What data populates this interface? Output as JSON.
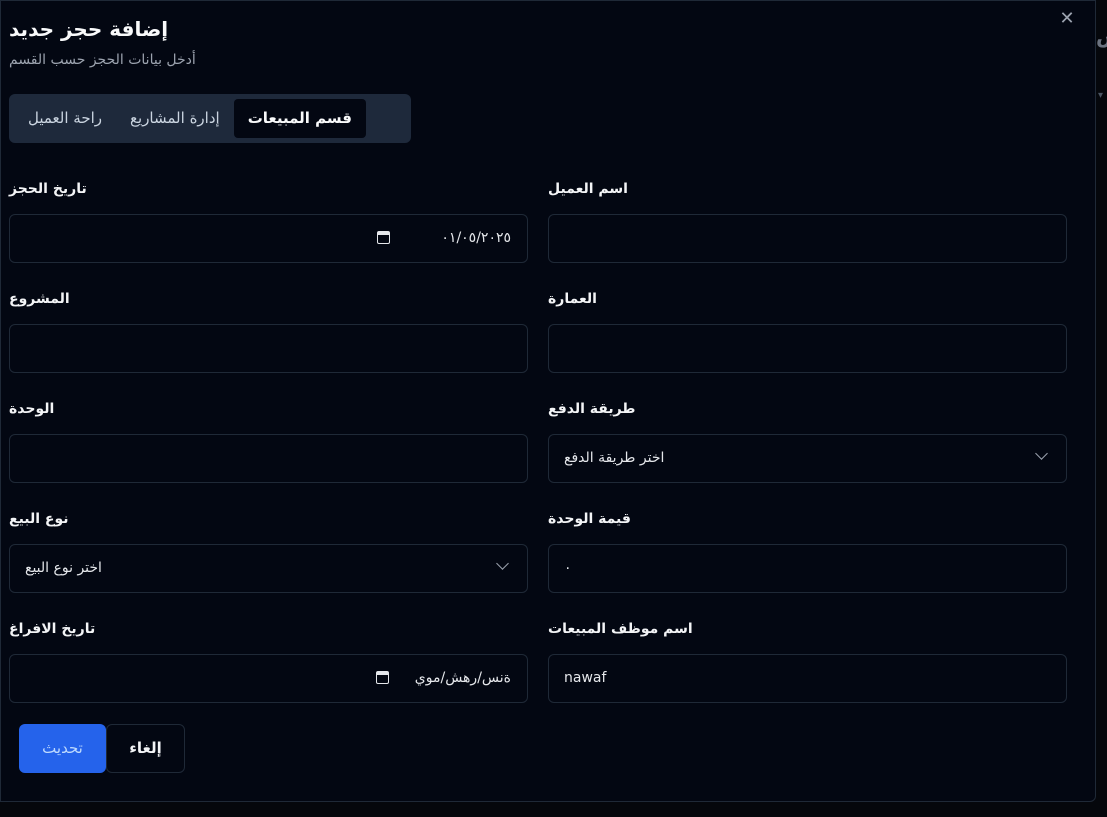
{
  "backdrop": {
    "partial_text": "س"
  },
  "dialog": {
    "title": "إضافة حجز جديد",
    "subtitle": "أدخل بيانات الحجز حسب القسم",
    "close_icon": "close-icon"
  },
  "tabs": [
    {
      "label": "قسم المبيعات",
      "active": true
    },
    {
      "label": "إدارة المشاريع",
      "active": false
    },
    {
      "label": "راحة العميل",
      "active": false
    }
  ],
  "form": {
    "customer_name": {
      "label": "اسم العميل",
      "value": ""
    },
    "booking_date": {
      "label": "تاريخ الحجز",
      "value": "٠١/٠٥/٢٠٢٥"
    },
    "building": {
      "label": "العمارة",
      "value": ""
    },
    "project": {
      "label": "المشروع",
      "value": ""
    },
    "payment_method": {
      "label": "طريقة الدفع",
      "placeholder": "اختر طريقة الدفع"
    },
    "unit": {
      "label": "الوحدة",
      "value": ""
    },
    "unit_value": {
      "label": "قيمة الوحدة",
      "value": "٠"
    },
    "sale_type": {
      "label": "نوع البيع",
      "placeholder": "اختر نوع البيع"
    },
    "sales_employee": {
      "label": "اسم موظف المبيعات",
      "value": "nawaf"
    },
    "handover_date": {
      "label": "تاريخ الافراغ",
      "value": "ةنس/رهش/موي"
    }
  },
  "buttons": {
    "update": "تحديث",
    "cancel": "إلغاء"
  },
  "colors": {
    "background": "#030712",
    "primary": "#2563eb",
    "tab_bar": "#1e293b",
    "border": "#1f2937"
  }
}
